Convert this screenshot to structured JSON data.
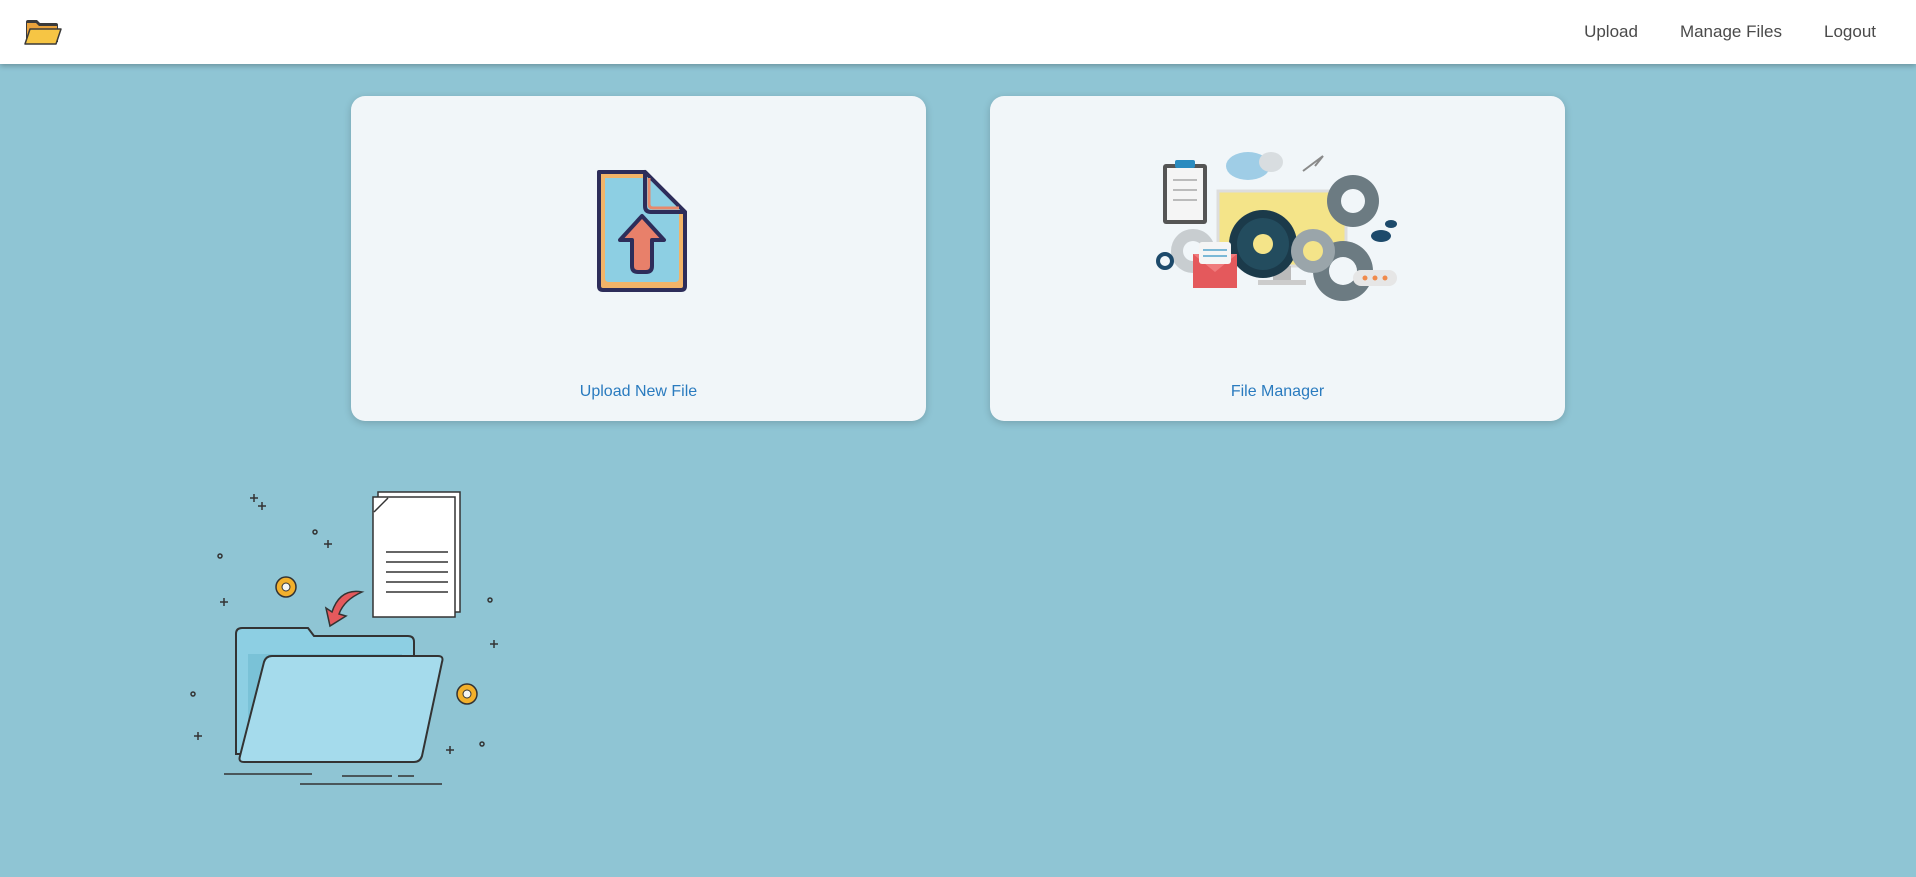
{
  "navbar": {
    "brand_icon": "folder-open-icon",
    "links": [
      {
        "label": "Upload"
      },
      {
        "label": "Manage Files"
      },
      {
        "label": "Logout"
      }
    ]
  },
  "cards": [
    {
      "label": "Upload New File",
      "illustration": "file-upload-icon"
    },
    {
      "label": "File Manager",
      "illustration": "file-management-illustration"
    }
  ],
  "decoration": {
    "illustration": "folder-documents-illustration"
  },
  "colors": {
    "background": "#8fc5d4",
    "navbar": "#ffffff",
    "card": "#f1f6f9",
    "link": "#2a7bbf",
    "nav_text": "#4a4a4a"
  }
}
